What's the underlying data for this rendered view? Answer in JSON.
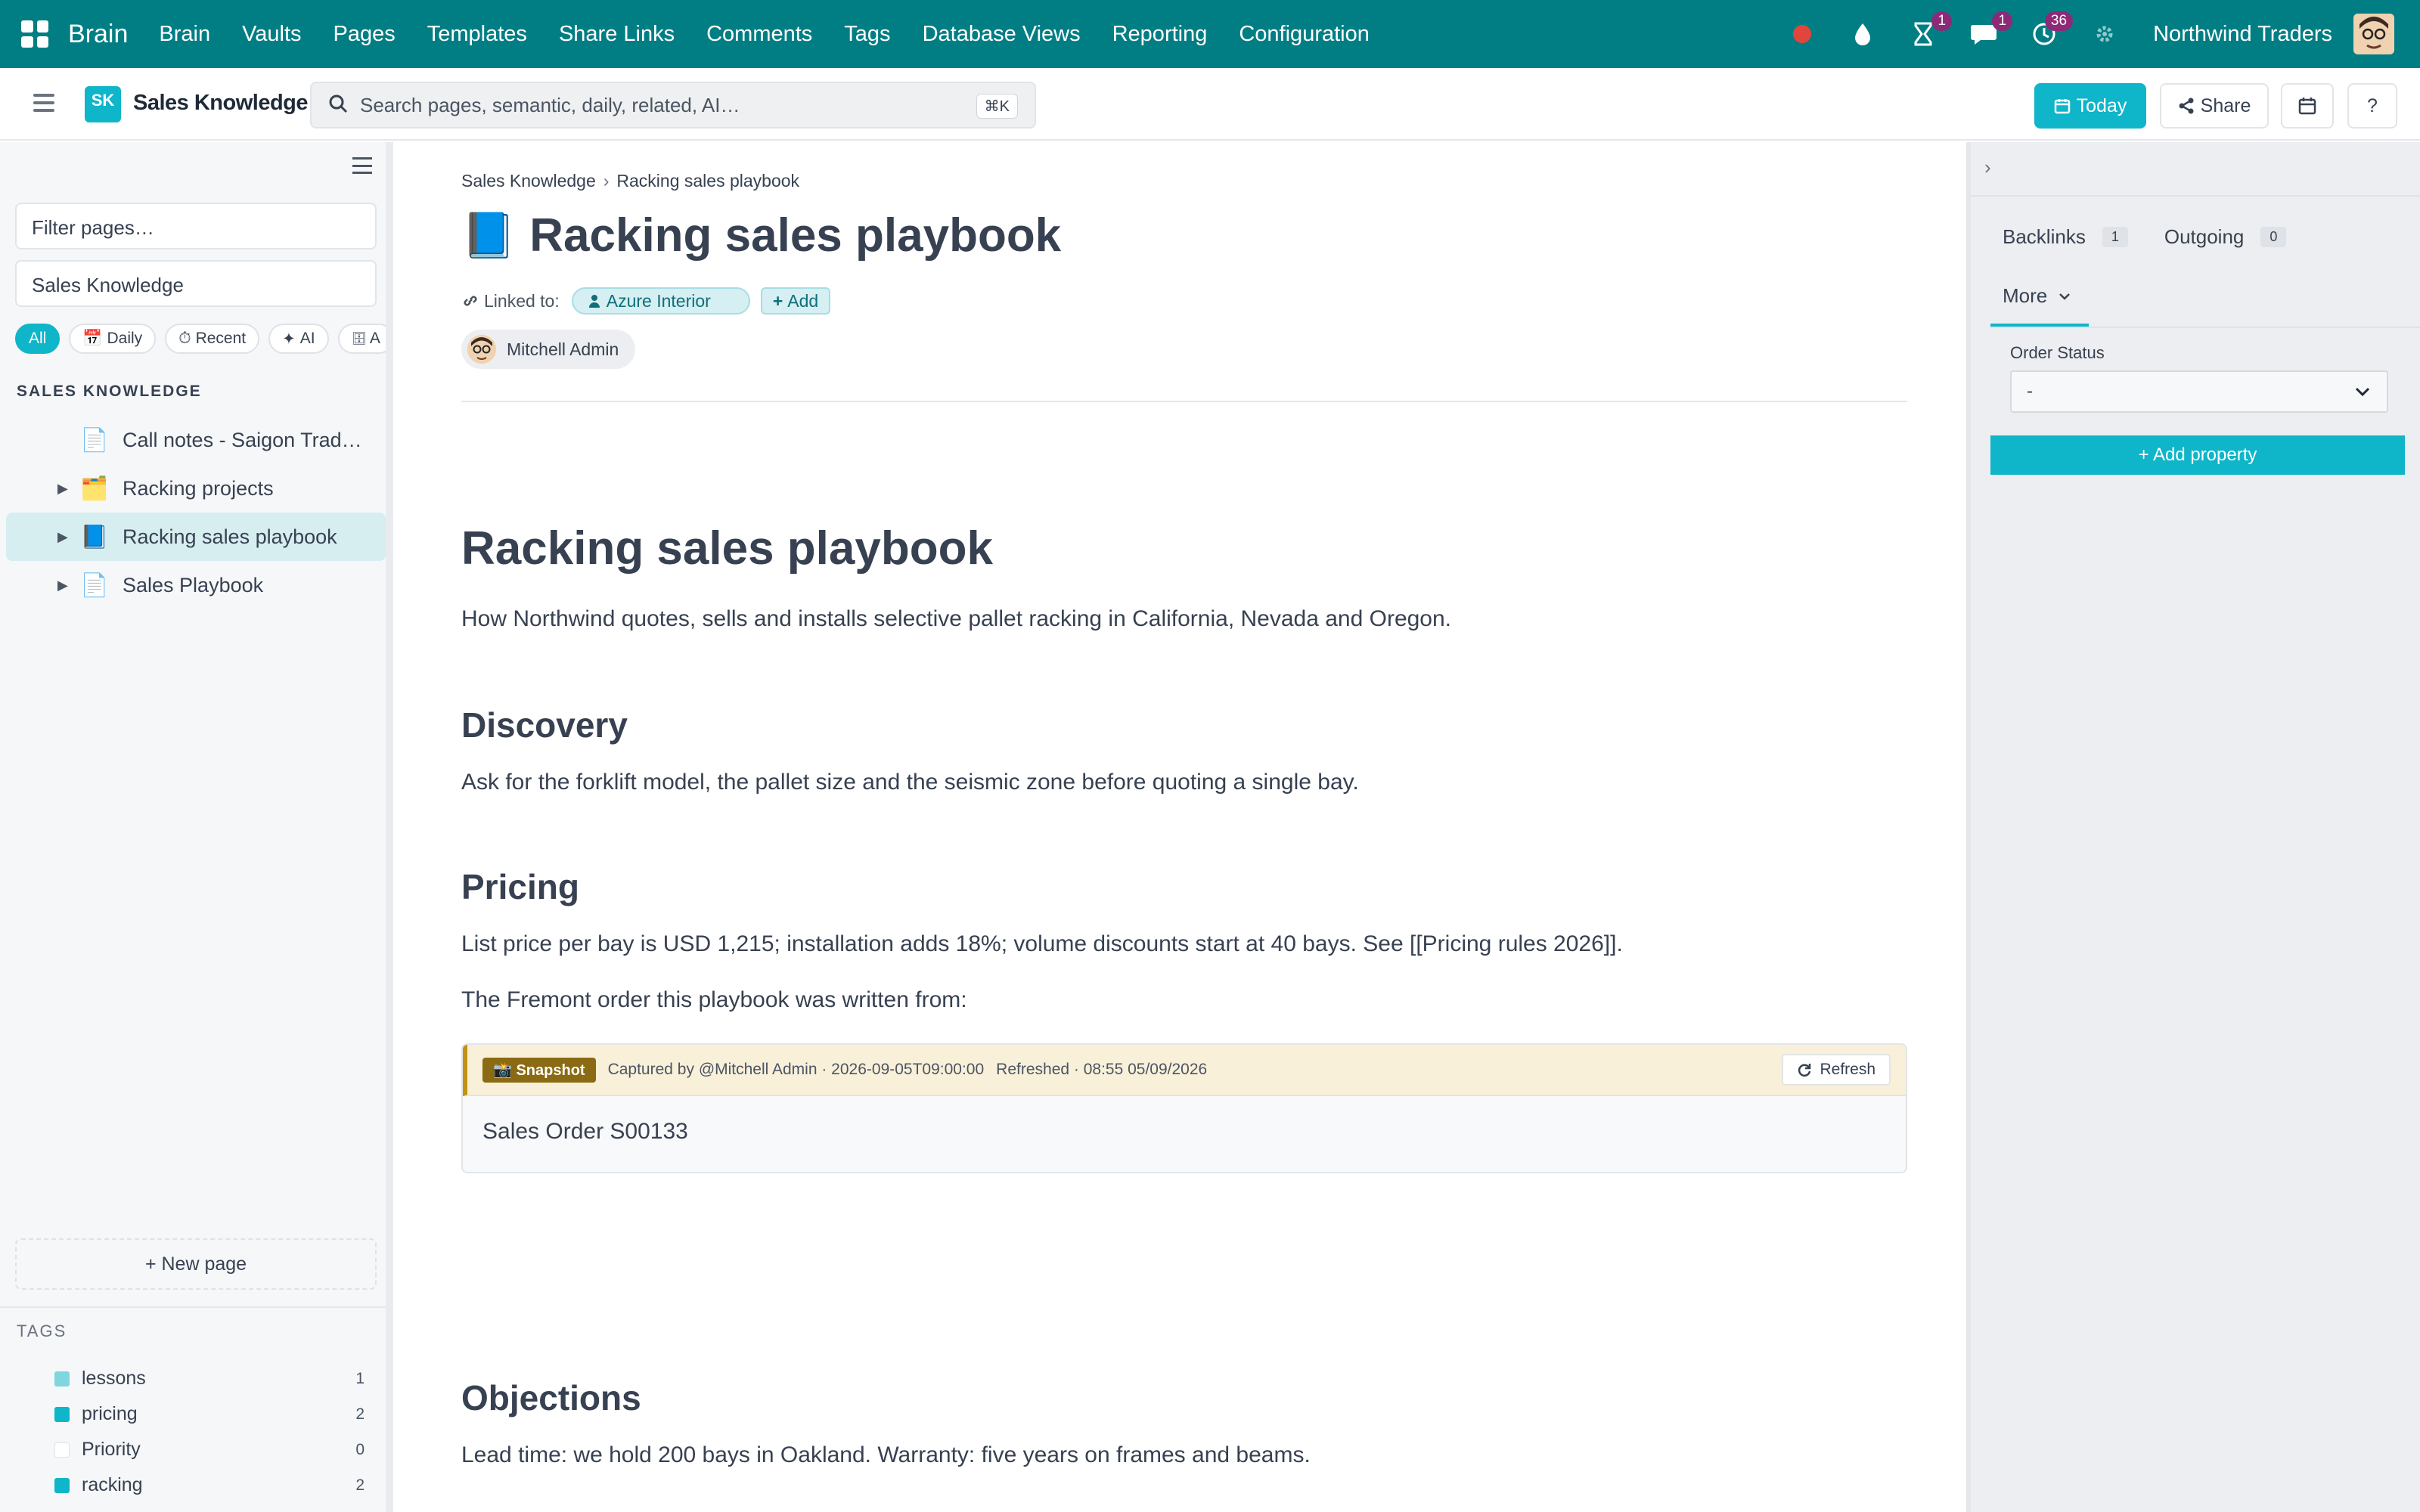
{
  "topnav": {
    "brand": "Brain",
    "menu": [
      "Brain",
      "Vaults",
      "Pages",
      "Templates",
      "Share Links",
      "Comments",
      "Tags",
      "Database Views",
      "Reporting",
      "Configuration"
    ],
    "icons": [
      {
        "name": "record-icon",
        "color": "#e0463c"
      },
      {
        "name": "drop-icon"
      },
      {
        "name": "hourglass-icon",
        "badge": "1"
      },
      {
        "name": "chat-icon",
        "badge": "1"
      },
      {
        "name": "activity-icon",
        "badge": "36"
      },
      {
        "name": "settings-icon"
      }
    ],
    "company": "Northwind Traders"
  },
  "subbar": {
    "vault_initials": "SK",
    "vault_name": "Sales Knowledge",
    "search_placeholder": "Search pages, semantic, daily, related, AI…",
    "search_shortcut": "⌘K",
    "today_label": "Today",
    "share_label": "Share",
    "help_label": "?"
  },
  "sidebar": {
    "filter_placeholder": "Filter pages…",
    "vault_select": "Sales Knowledge",
    "chips": [
      {
        "label": "All",
        "icon": "",
        "active": true
      },
      {
        "label": "Daily",
        "icon": "📅",
        "active": false
      },
      {
        "label": "Recent",
        "icon": "⏱",
        "active": false
      },
      {
        "label": "AI",
        "icon": "✦",
        "active": false
      },
      {
        "label": "A",
        "icon": "🗄",
        "active": false
      }
    ],
    "section_label": "SALES KNOWLEDGE",
    "tree": [
      {
        "label": "Call notes - Saigon Tradi…",
        "icon": "📄",
        "has_children": false,
        "active": false
      },
      {
        "label": "Racking projects",
        "icon": "🗂️",
        "has_children": true,
        "active": false
      },
      {
        "label": "Racking sales playbook",
        "icon": "📘",
        "has_children": true,
        "active": true
      },
      {
        "label": "Sales Playbook",
        "icon": "📄",
        "has_children": true,
        "active": false
      }
    ],
    "new_page": "+ New page",
    "tags_label": "TAGS",
    "tags": [
      {
        "name": "lessons",
        "count": "1",
        "color": "#7fd6de"
      },
      {
        "name": "pricing",
        "count": "2",
        "color": "#0fb5c9"
      },
      {
        "name": "Priority",
        "count": "0",
        "color": "#ffffff"
      },
      {
        "name": "racking",
        "count": "2",
        "color": "#0fb5c9"
      }
    ]
  },
  "main": {
    "breadcrumb": [
      "Sales Knowledge",
      "Racking sales playbook"
    ],
    "breadcrumb_sep": "›",
    "title_icon": "📘",
    "title": "Racking sales playbook",
    "linked_label": "Linked to:",
    "linked_chip": "Azure Interior",
    "add_label": "Add",
    "author": "Mitchell Admin",
    "h1": "Racking sales playbook",
    "intro": "How Northwind quotes, sells and installs selective pallet racking in California, Nevada and Oregon.",
    "discovery_heading": "Discovery",
    "discovery_text": "Ask for the forklift model, the pallet size and the seismic zone before quoting a single bay.",
    "pricing_heading": "Pricing",
    "pricing_text": "List price per bay is USD 1,215; installation adds 18%; volume discounts start at 40 bays. See [[Pricing rules 2026]].",
    "order_text": "The Fremont order this playbook was written from:",
    "snapshot": {
      "badge": "📸 Snapshot",
      "captured": "Captured by @Mitchell Admin · 2026-09-05T09:00:00",
      "refreshed": "Refreshed · 08:55 05/09/2026",
      "refresh_label": "Refresh",
      "body": "Sales Order S00133"
    },
    "objections_heading": "Objections",
    "objections_text": "Lead time: we hold 200 bays in Oakland. Warranty: five years on frames and beams."
  },
  "rpanel": {
    "backlinks_label": "Backlinks",
    "backlinks_count": "1",
    "outgoing_label": "Outgoing",
    "outgoing_count": "0",
    "more_label": "More",
    "prop_label": "Order Status",
    "prop_value": "-",
    "add_property": "+ Add property"
  }
}
